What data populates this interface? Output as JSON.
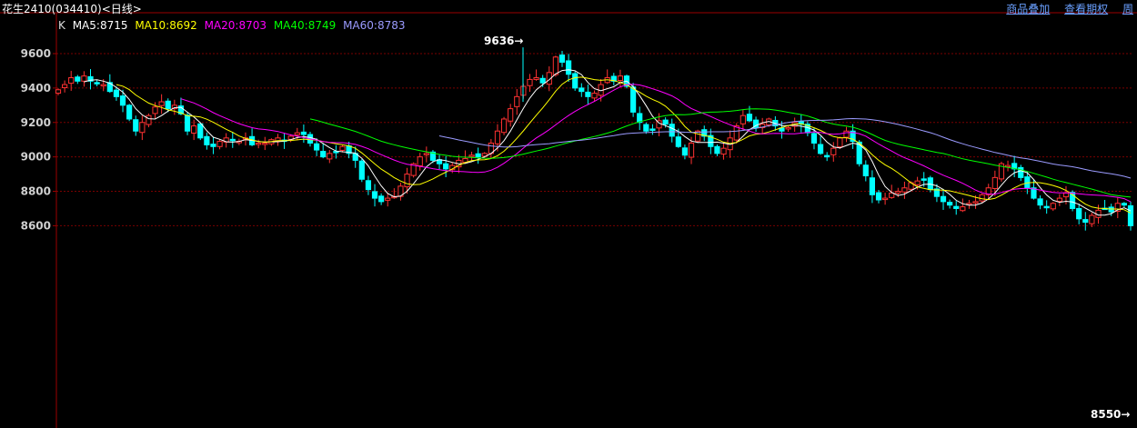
{
  "header": {
    "title": "花生2410(034410)<日线>",
    "links": [
      "商品叠加",
      "查看期权",
      "周"
    ]
  },
  "legend": {
    "k_label": "K",
    "items": [
      {
        "label": "MA5:8715",
        "color": "#ffffff"
      },
      {
        "label": "MA10:8692",
        "color": "#ffff00"
      },
      {
        "label": "MA20:8703",
        "color": "#ff00ff"
      },
      {
        "label": "MA40:8749",
        "color": "#00ff00"
      },
      {
        "label": "MA60:8783",
        "color": "#9b9bff"
      }
    ]
  },
  "chart_data": {
    "type": "candlestick",
    "title": "",
    "y_ticks": [
      9600,
      9400,
      9200,
      9000,
      8800,
      8600
    ],
    "ylim": [
      8550,
      9700
    ],
    "grid": true,
    "colors": {
      "up": "#ff3232",
      "down": "#00ffff",
      "grid": "#7a0000",
      "axis": "#9b0000"
    },
    "annotations": [
      {
        "text": "9636",
        "value": 9636,
        "arrow": "→",
        "position": "top"
      },
      {
        "text": "8550",
        "value": 8550,
        "arrow": "→",
        "position": "bottom-right"
      }
    ],
    "close_series": [
      9390,
      9420,
      9460,
      9440,
      9470,
      9440,
      9430,
      9420,
      9380,
      9350,
      9300,
      9220,
      9150,
      9200,
      9240,
      9290,
      9320,
      9280,
      9300,
      9250,
      9150,
      9180,
      9110,
      9070,
      9060,
      9090,
      9110,
      9100,
      9090,
      9110,
      9070,
      9080,
      9080,
      9100,
      9110,
      9090,
      9120,
      9140,
      9130,
      9080,
      9040,
      9000,
      9020,
      9030,
      9060,
      9020,
      8980,
      8870,
      8810,
      8760,
      8740,
      8760,
      8770,
      8830,
      8900,
      8960,
      9000,
      9020,
      8980,
      8960,
      8930,
      8950,
      8980,
      8990,
      9010,
      9000,
      9020,
      9080,
      9150,
      9220,
      9280,
      9350,
      9410,
      9450,
      9460,
      9430,
      9490,
      9580,
      9550,
      9480,
      9400,
      9380,
      9350,
      9370,
      9420,
      9460,
      9440,
      9470,
      9410,
      9260,
      9200,
      9150,
      9160,
      9210,
      9190,
      9120,
      9060,
      9010,
      9080,
      9150,
      9120,
      9060,
      9020,
      9050,
      9110,
      9180,
      9240,
      9210,
      9170,
      9190,
      9220,
      9180,
      9150,
      9170,
      9200,
      9190,
      9140,
      9080,
      9020,
      9000,
      9050,
      9110,
      9150,
      9090,
      8960,
      8890,
      8780,
      8750,
      8760,
      8790,
      8800,
      8820,
      8850,
      8860,
      8870,
      8810,
      8770,
      8740,
      8720,
      8700,
      8710,
      8730,
      8740,
      8780,
      8820,
      8880,
      8960,
      8950,
      8930,
      8880,
      8820,
      8760,
      8720,
      8710,
      8730,
      8760,
      8790,
      8700,
      8640,
      8620,
      8660,
      8690,
      8700,
      8680,
      8730,
      8720,
      8600
    ]
  }
}
